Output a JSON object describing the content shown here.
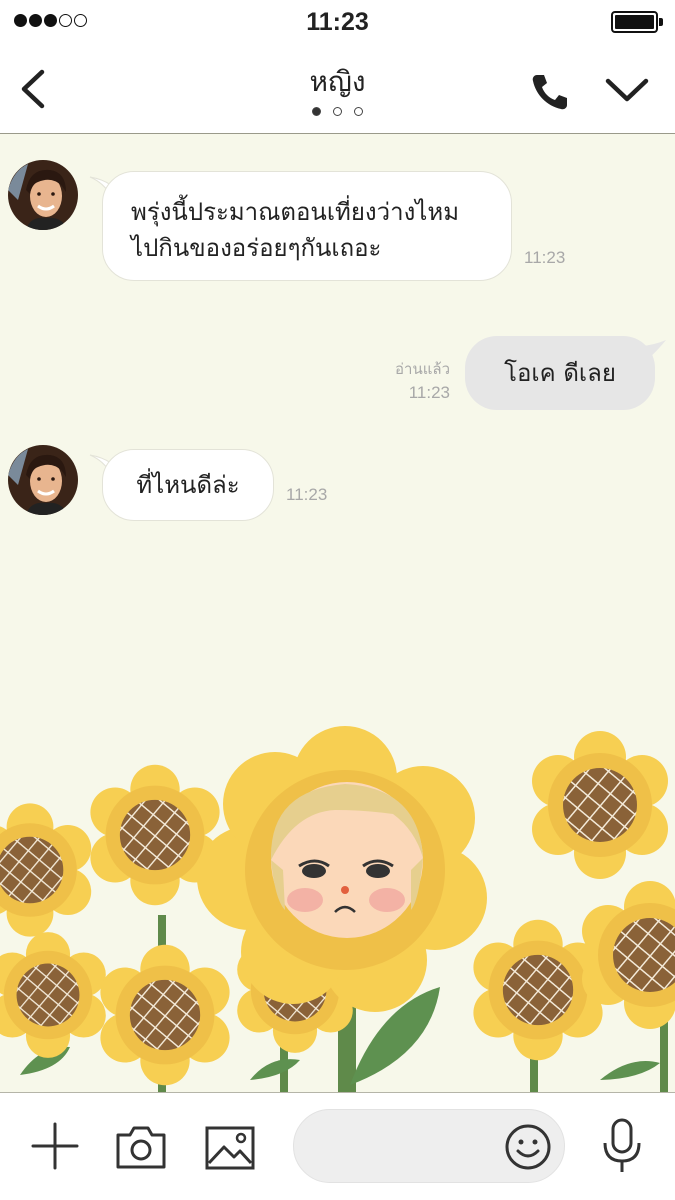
{
  "status_bar": {
    "time": "11:23",
    "signal_level": 3,
    "signal_max": 5
  },
  "header": {
    "title": "หญิง",
    "page_dots_total": 3,
    "page_dots_active": 1,
    "icons": [
      "back-chevron-icon",
      "phone-icon",
      "chevron-down-icon"
    ]
  },
  "messages": [
    {
      "direction": "incoming",
      "lines": [
        "พรุ่งนี้ประมาณตอนเที่ยงว่างไหม",
        "ไปกินของอร่อยๆกันเถอะ"
      ],
      "time": "11:23"
    },
    {
      "direction": "outgoing",
      "text": "โอเค ดีเลย",
      "read_label": "อ่านแล้ว",
      "time": "11:23"
    },
    {
      "direction": "incoming",
      "text": "ที่ไหนดีล่ะ",
      "time": "11:23"
    }
  ],
  "sticker": {
    "icon": "sunflower-girl-sticker"
  },
  "input_bar": {
    "placeholder": "",
    "icons": [
      "plus-icon",
      "camera-icon",
      "image-icon",
      "smiley-icon",
      "microphone-icon"
    ]
  },
  "colors": {
    "chat_background": "#f7f8ea",
    "incoming_bubble": "#ffffff",
    "outgoing_bubble": "#e6e6e6",
    "timestamp": "#a8a8a8",
    "sunflower_petal": "#f7cf52",
    "sunflower_center": "#8a6238"
  }
}
